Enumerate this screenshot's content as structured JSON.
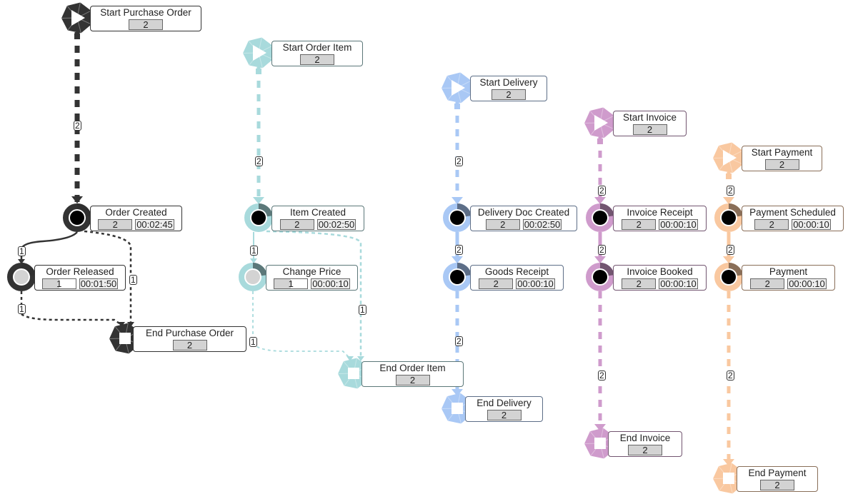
{
  "diagram": {
    "type": "object-centric process map",
    "lanes": [
      {
        "id": "purchase_order",
        "color": "#333333",
        "nodes": [
          {
            "id": "start_po",
            "kind": "start",
            "label": "Start Purchase Order",
            "count": "2"
          },
          {
            "id": "order_created",
            "kind": "activity",
            "label": "Order Created",
            "count": "2",
            "duration": "00:02:45",
            "fill": 1.0
          },
          {
            "id": "order_released",
            "kind": "activity",
            "label": "Order Released",
            "count": "1",
            "duration": "00:01:50",
            "fill": 0.5
          },
          {
            "id": "end_po",
            "kind": "end",
            "label": "End Purchase Order",
            "count": "2"
          }
        ],
        "edges": [
          {
            "from": "start_po",
            "to": "order_created",
            "label": "2"
          },
          {
            "from": "order_created",
            "to": "order_released",
            "label": "1"
          },
          {
            "from": "order_created",
            "to": "end_po",
            "label": "1"
          },
          {
            "from": "order_released",
            "to": "end_po",
            "label": "1"
          }
        ]
      },
      {
        "id": "order_item",
        "color": "#a8dadc",
        "nodes": [
          {
            "id": "start_oi",
            "kind": "start",
            "label": "Start Order Item",
            "count": "2"
          },
          {
            "id": "item_created",
            "kind": "activity",
            "label": "Item Created",
            "count": "2",
            "duration": "00:02:50",
            "fill": 1.0
          },
          {
            "id": "change_price",
            "kind": "activity",
            "label": "Change Price",
            "count": "1",
            "duration": "00:00:10",
            "fill": 0.5
          },
          {
            "id": "end_oi",
            "kind": "end",
            "label": "End Order Item",
            "count": "2"
          }
        ],
        "edges": [
          {
            "from": "start_oi",
            "to": "item_created",
            "label": "2"
          },
          {
            "from": "item_created",
            "to": "change_price",
            "label": "1"
          },
          {
            "from": "item_created",
            "to": "end_oi",
            "label": "1"
          },
          {
            "from": "change_price",
            "to": "end_oi",
            "label": "1"
          }
        ]
      },
      {
        "id": "delivery",
        "color": "#a9c8f5",
        "nodes": [
          {
            "id": "start_dl",
            "kind": "start",
            "label": "Start Delivery",
            "count": "2"
          },
          {
            "id": "delivery_doc_created",
            "kind": "activity",
            "label": "Delivery Doc Created",
            "count": "2",
            "duration": "00:02:50",
            "fill": 1.0
          },
          {
            "id": "goods_receipt",
            "kind": "activity",
            "label": "Goods Receipt",
            "count": "2",
            "duration": "00:00:10",
            "fill": 1.0
          },
          {
            "id": "end_dl",
            "kind": "end",
            "label": "End Delivery",
            "count": "2"
          }
        ],
        "edges": [
          {
            "from": "start_dl",
            "to": "delivery_doc_created",
            "label": "2"
          },
          {
            "from": "delivery_doc_created",
            "to": "goods_receipt",
            "label": "2"
          },
          {
            "from": "goods_receipt",
            "to": "end_dl",
            "label": "2"
          }
        ]
      },
      {
        "id": "invoice",
        "color": "#cf9bcc",
        "nodes": [
          {
            "id": "start_in",
            "kind": "start",
            "label": "Start Invoice",
            "count": "2"
          },
          {
            "id": "invoice_receipt",
            "kind": "activity",
            "label": "Invoice Receipt",
            "count": "2",
            "duration": "00:00:10",
            "fill": 1.0
          },
          {
            "id": "invoice_booked",
            "kind": "activity",
            "label": "Invoice Booked",
            "count": "2",
            "duration": "00:00:10",
            "fill": 1.0
          },
          {
            "id": "end_in",
            "kind": "end",
            "label": "End Invoice",
            "count": "2"
          }
        ],
        "edges": [
          {
            "from": "start_in",
            "to": "invoice_receipt",
            "label": "2"
          },
          {
            "from": "invoice_receipt",
            "to": "invoice_booked",
            "label": "2"
          },
          {
            "from": "invoice_booked",
            "to": "end_in",
            "label": "2"
          }
        ]
      },
      {
        "id": "payment",
        "color": "#f9c8a0",
        "nodes": [
          {
            "id": "start_pa",
            "kind": "start",
            "label": "Start Payment",
            "count": "2"
          },
          {
            "id": "payment_scheduled",
            "kind": "activity",
            "label": "Payment Scheduled",
            "count": "2",
            "duration": "00:00:10",
            "fill": 1.0
          },
          {
            "id": "payment",
            "kind": "activity",
            "label": "Payment",
            "count": "2",
            "duration": "00:00:10",
            "fill": 1.0
          },
          {
            "id": "end_pa",
            "kind": "end",
            "label": "End Payment",
            "count": "2"
          }
        ],
        "edges": [
          {
            "from": "start_pa",
            "to": "payment_scheduled",
            "label": "2"
          },
          {
            "from": "payment_scheduled",
            "to": "payment",
            "label": "2"
          },
          {
            "from": "payment",
            "to": "end_pa",
            "label": "2"
          }
        ]
      }
    ]
  }
}
